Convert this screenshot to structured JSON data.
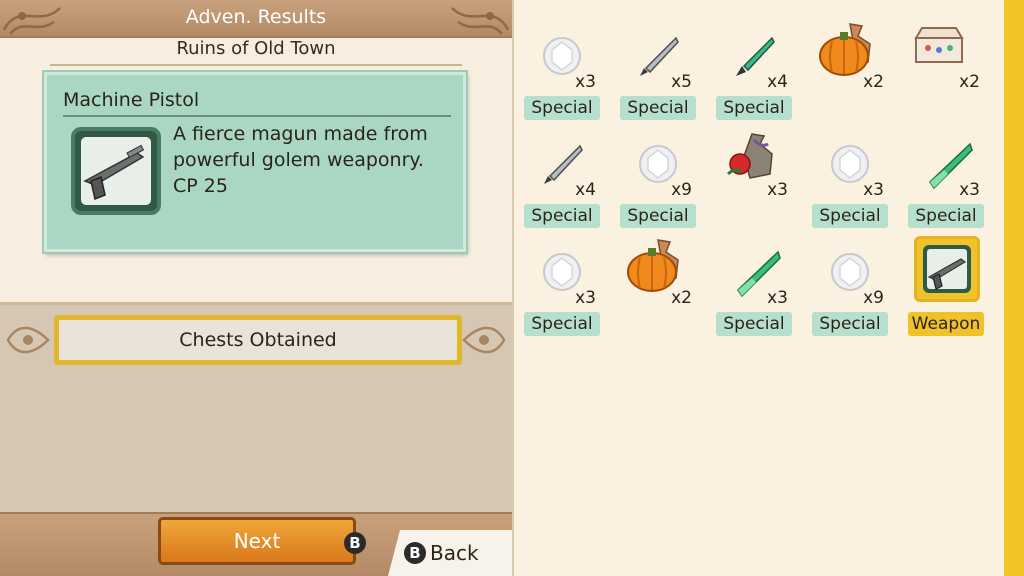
{
  "header": {
    "title": "Adven. Results",
    "location": "Ruins of Old Town"
  },
  "item": {
    "name": "Machine Pistol",
    "description": "A fierce magun made from powerful golem weaponry.",
    "stat": "CP 25",
    "icon": "pistol-icon"
  },
  "chests_label": "Chests Obtained",
  "buttons": {
    "next_label": "Next",
    "next_key": "B",
    "back_key": "B",
    "back_label": "Back"
  },
  "loot": [
    {
      "icon": "crystal-orb-icon",
      "qty": "x3",
      "tag": "Special"
    },
    {
      "icon": "silver-dagger-icon",
      "qty": "x5",
      "tag": "Special"
    },
    {
      "icon": "green-dagger-icon",
      "qty": "x4",
      "tag": "Special"
    },
    {
      "icon": "pumpkin-bag-icon",
      "qty": "x2",
      "tag": ""
    },
    {
      "icon": "jewel-box-icon",
      "qty": "x2",
      "tag": ""
    },
    {
      "icon": "silver-dagger-icon",
      "qty": "x4",
      "tag": "Special"
    },
    {
      "icon": "crystal-orb-icon",
      "qty": "x9",
      "tag": "Special"
    },
    {
      "icon": "rose-bag-icon",
      "qty": "x3",
      "tag": ""
    },
    {
      "icon": "crystal-orb-icon",
      "qty": "x3",
      "tag": "Special"
    },
    {
      "icon": "green-crystal-icon",
      "qty": "x3",
      "tag": "Special"
    },
    {
      "icon": "crystal-orb-icon",
      "qty": "x3",
      "tag": "Special"
    },
    {
      "icon": "pumpkin-bag-icon",
      "qty": "x2",
      "tag": ""
    },
    {
      "icon": "green-crystal-icon",
      "qty": "x3",
      "tag": "Special"
    },
    {
      "icon": "crystal-orb-icon",
      "qty": "x9",
      "tag": "Special"
    },
    {
      "icon": "pistol-icon",
      "qty": "",
      "tag": "Weapon"
    }
  ]
}
